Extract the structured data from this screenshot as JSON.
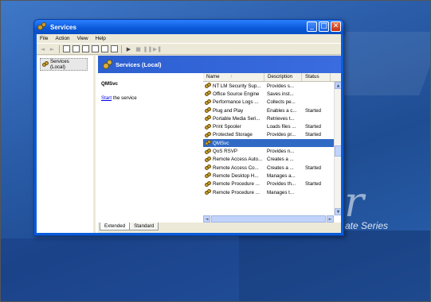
{
  "window": {
    "title": "Services"
  },
  "menu": [
    "File",
    "Action",
    "View",
    "Help"
  ],
  "tree": {
    "root_label": "Services (Local)"
  },
  "pane": {
    "header": "Services (Local)"
  },
  "description": {
    "service_name": "QMSvc",
    "link_text": "Start",
    "link_suffix": " the service"
  },
  "list": {
    "columns": {
      "name": "Name",
      "description": "Description",
      "status": "Status"
    },
    "rows": [
      {
        "name": "NT LM Security Sup...",
        "description": "Provides s...",
        "status": ""
      },
      {
        "name": "Office Source Engine",
        "description": "Saves inst...",
        "status": ""
      },
      {
        "name": "Performance Logs ...",
        "description": "Collects pe...",
        "status": ""
      },
      {
        "name": "Plug and Play",
        "description": "Enables a c...",
        "status": "Started"
      },
      {
        "name": "Portable Media Seri...",
        "description": "Retrieves t...",
        "status": ""
      },
      {
        "name": "Print Spooler",
        "description": "Loads files ...",
        "status": "Started"
      },
      {
        "name": "Protected Storage",
        "description": "Provides pr...",
        "status": "Started"
      },
      {
        "name": "QMSvc",
        "description": "",
        "status": ""
      },
      {
        "name": "QoS RSVP",
        "description": "Provides n...",
        "status": ""
      },
      {
        "name": "Remote Access Auto...",
        "description": "Creates a ...",
        "status": ""
      },
      {
        "name": "Remote Access Co...",
        "description": "Creates a ...",
        "status": "Started"
      },
      {
        "name": "Remote Desktop H...",
        "description": "Manages a...",
        "status": ""
      },
      {
        "name": "Remote Procedure ...",
        "description": "Provides th...",
        "status": "Started"
      },
      {
        "name": "Remote Procedure ...",
        "description": "Manages t...",
        "status": ""
      }
    ],
    "selected_index": 7
  },
  "tabs": {
    "extended": "Extended",
    "standard": "Standard"
  },
  "desktop": {
    "brand_glyph": "r",
    "brand_text": "ate Series"
  },
  "colors": {
    "titlebar": "#0a58d8",
    "selection": "#316ac5",
    "pane_header": "#2c5fd0",
    "link": "#0000ee"
  },
  "icons": [
    "services-gear-icon",
    "back-arrow-icon",
    "forward-arrow-icon",
    "play-icon",
    "stop-icon",
    "pause-icon",
    "restart-icon"
  ]
}
